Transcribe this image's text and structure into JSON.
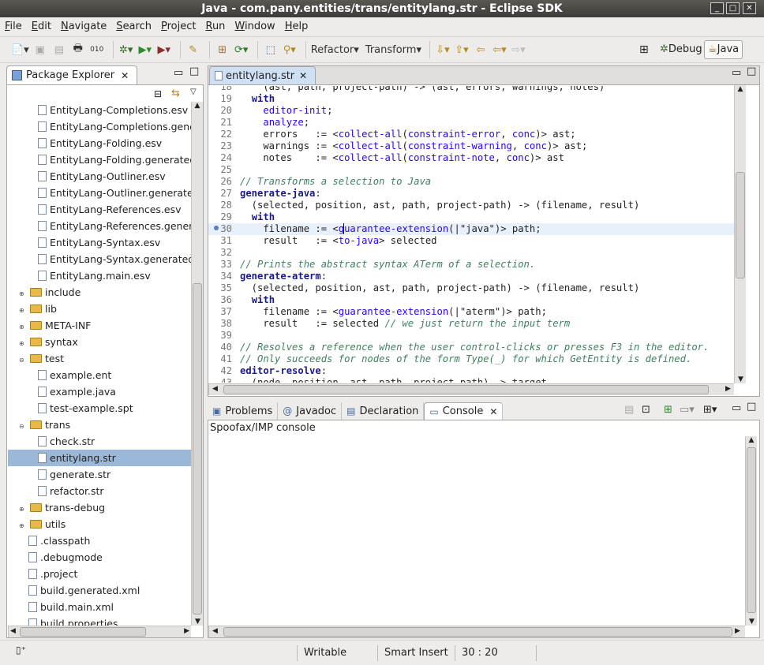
{
  "window": {
    "title": "Java - com.pany.entities/trans/entitylang.str - Eclipse SDK"
  },
  "menu": [
    "File",
    "Edit",
    "Navigate",
    "Search",
    "Project",
    "Run",
    "Window",
    "Help"
  ],
  "toolbar": {
    "refactor": "Refactor",
    "transform": "Transform",
    "perspectives": [
      "Debug",
      "Java"
    ]
  },
  "explorer": {
    "title": "Package Explorer",
    "items": [
      {
        "label": "EntityLang-Completions.esv",
        "type": "file",
        "depth": 2
      },
      {
        "label": "EntityLang-Completions.generated.esv",
        "type": "file",
        "depth": 2
      },
      {
        "label": "EntityLang-Folding.esv",
        "type": "file",
        "depth": 2
      },
      {
        "label": "EntityLang-Folding.generated.esv",
        "type": "file",
        "depth": 2
      },
      {
        "label": "EntityLang-Outliner.esv",
        "type": "file",
        "depth": 2
      },
      {
        "label": "EntityLang-Outliner.generated.esv",
        "type": "file",
        "depth": 2
      },
      {
        "label": "EntityLang-References.esv",
        "type": "file",
        "depth": 2
      },
      {
        "label": "EntityLang-References.generated.esv",
        "type": "file",
        "depth": 2
      },
      {
        "label": "EntityLang-Syntax.esv",
        "type": "file",
        "depth": 2
      },
      {
        "label": "EntityLang-Syntax.generated.esv",
        "type": "file",
        "depth": 2
      },
      {
        "label": "EntityLang.main.esv",
        "type": "file",
        "depth": 2
      },
      {
        "label": "include",
        "type": "folder",
        "depth": 1,
        "twisty": "▸"
      },
      {
        "label": "lib",
        "type": "folder",
        "depth": 1,
        "twisty": "▸"
      },
      {
        "label": "META-INF",
        "type": "folder",
        "depth": 1,
        "twisty": "▸"
      },
      {
        "label": "syntax",
        "type": "folder",
        "depth": 1,
        "twisty": "▸"
      },
      {
        "label": "test",
        "type": "folder",
        "depth": 1,
        "twisty": "▾"
      },
      {
        "label": "example.ent",
        "type": "file",
        "depth": 2
      },
      {
        "label": "example.java",
        "type": "file",
        "depth": 2
      },
      {
        "label": "test-example.spt",
        "type": "file",
        "depth": 2
      },
      {
        "label": "trans",
        "type": "folder",
        "depth": 1,
        "twisty": "▾"
      },
      {
        "label": "check.str",
        "type": "file",
        "depth": 2
      },
      {
        "label": "entitylang.str",
        "type": "file",
        "depth": 2,
        "selected": true
      },
      {
        "label": "generate.str",
        "type": "file",
        "depth": 2
      },
      {
        "label": "refactor.str",
        "type": "file",
        "depth": 2
      },
      {
        "label": "trans-debug",
        "type": "folder",
        "depth": 1,
        "twisty": "▸"
      },
      {
        "label": "utils",
        "type": "folder",
        "depth": 1,
        "twisty": "▸"
      },
      {
        "label": ".classpath",
        "type": "file",
        "depth": 1
      },
      {
        "label": ".debugmode",
        "type": "file",
        "depth": 1
      },
      {
        "label": ".project",
        "type": "file",
        "depth": 1
      },
      {
        "label": "build.generated.xml",
        "type": "file",
        "depth": 1
      },
      {
        "label": "build.main.xml",
        "type": "file",
        "depth": 1
      },
      {
        "label": "build.properties",
        "type": "file",
        "depth": 1
      }
    ]
  },
  "editor": {
    "tab": "entitylang.str",
    "lines": [
      {
        "n": "18",
        "parts": [
          [
            "",
            "    (ast, path, project-path) -> (ast, errors, warnings, notes)"
          ]
        ]
      },
      {
        "n": "19",
        "parts": [
          [
            "",
            "  "
          ],
          [
            "kw",
            "with"
          ]
        ]
      },
      {
        "n": "20",
        "parts": [
          [
            "",
            "    "
          ],
          [
            "st",
            "editor-init"
          ],
          [
            "",
            ";"
          ]
        ]
      },
      {
        "n": "21",
        "parts": [
          [
            "",
            "    "
          ],
          [
            "st",
            "analyze"
          ],
          [
            "",
            ";"
          ]
        ]
      },
      {
        "n": "22",
        "parts": [
          [
            "",
            "    errors   := <"
          ],
          [
            "st",
            "collect-all"
          ],
          [
            "",
            "("
          ],
          [
            "st",
            "constraint-error"
          ],
          [
            "",
            ", "
          ],
          [
            "st",
            "conc"
          ],
          [
            "",
            ")> ast;"
          ]
        ]
      },
      {
        "n": "23",
        "parts": [
          [
            "",
            "    warnings := <"
          ],
          [
            "st",
            "collect-all"
          ],
          [
            "",
            "("
          ],
          [
            "st",
            "constraint-warning"
          ],
          [
            "",
            ", "
          ],
          [
            "st",
            "conc"
          ],
          [
            "",
            ")> ast;"
          ]
        ]
      },
      {
        "n": "24",
        "parts": [
          [
            "",
            "    notes    := <"
          ],
          [
            "st",
            "collect-all"
          ],
          [
            "",
            "("
          ],
          [
            "st",
            "constraint-note"
          ],
          [
            "",
            ", "
          ],
          [
            "st",
            "conc"
          ],
          [
            "",
            ")> ast"
          ]
        ]
      },
      {
        "n": "25",
        "parts": [
          [
            "",
            ""
          ]
        ]
      },
      {
        "n": "26",
        "parts": [
          [
            "cm",
            "// Transforms a selection to Java"
          ]
        ]
      },
      {
        "n": "27",
        "parts": [
          [
            "kw",
            "generate-java"
          ],
          [
            "",
            ":"
          ]
        ]
      },
      {
        "n": "28",
        "parts": [
          [
            "",
            "  (selected, position, ast, path, project-path) -> (filename, result)"
          ]
        ]
      },
      {
        "n": "29",
        "parts": [
          [
            "",
            "  "
          ],
          [
            "kw",
            "with"
          ]
        ]
      },
      {
        "n": "30",
        "hl": true,
        "parts": [
          [
            "",
            "    filename := <"
          ],
          [
            "st",
            "guarantee-extension"
          ],
          [
            "",
            "(|\"java\")> path;"
          ]
        ]
      },
      {
        "n": "31",
        "parts": [
          [
            "",
            "    result   := <"
          ],
          [
            "st",
            "to-java"
          ],
          [
            "",
            "> selected"
          ]
        ]
      },
      {
        "n": "32",
        "parts": [
          [
            "",
            ""
          ]
        ]
      },
      {
        "n": "33",
        "parts": [
          [
            "cm",
            "// Prints the abstract syntax ATerm of a selection."
          ]
        ]
      },
      {
        "n": "34",
        "parts": [
          [
            "kw",
            "generate-aterm"
          ],
          [
            "",
            ":"
          ]
        ]
      },
      {
        "n": "35",
        "parts": [
          [
            "",
            "  (selected, position, ast, path, project-path) -> (filename, result)"
          ]
        ]
      },
      {
        "n": "36",
        "parts": [
          [
            "",
            "  "
          ],
          [
            "kw",
            "with"
          ]
        ]
      },
      {
        "n": "37",
        "parts": [
          [
            "",
            "    filename := <"
          ],
          [
            "st",
            "guarantee-extension"
          ],
          [
            "",
            "(|\"aterm\")> path;"
          ]
        ]
      },
      {
        "n": "38",
        "parts": [
          [
            "",
            "    result   := selected "
          ],
          [
            "cm",
            "// we just return the input term"
          ]
        ]
      },
      {
        "n": "39",
        "parts": [
          [
            "",
            ""
          ]
        ]
      },
      {
        "n": "40",
        "parts": [
          [
            "cm",
            "// Resolves a reference when the user control-clicks or presses F3 in the editor."
          ]
        ]
      },
      {
        "n": "41",
        "parts": [
          [
            "cm",
            "// Only succeeds for nodes of the form Type(_) for which GetEntity is defined."
          ]
        ]
      },
      {
        "n": "42",
        "parts": [
          [
            "kw",
            "editor-resolve"
          ],
          [
            "",
            ":"
          ]
        ]
      },
      {
        "n": "43",
        "parts": [
          [
            "",
            "  (node, position, ast, path, project-path) -> target"
          ]
        ]
      }
    ]
  },
  "bottom": {
    "tabs": [
      "Problems",
      "Javadoc",
      "Declaration",
      "Console"
    ],
    "active": "Console",
    "console_name": "Spoofax/IMP console"
  },
  "status": {
    "writable": "Writable",
    "insert": "Smart Insert",
    "position": "30 : 20"
  }
}
